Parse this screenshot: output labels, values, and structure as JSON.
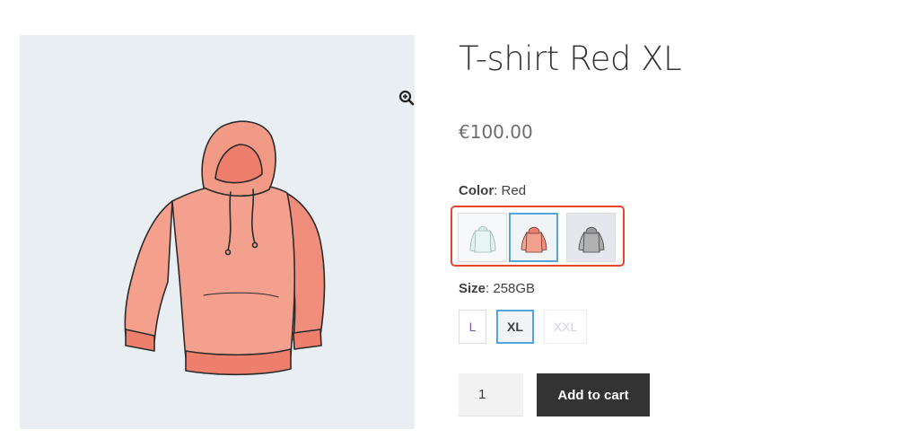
{
  "product": {
    "title": "T-shirt Red XL",
    "price": "€100.00"
  },
  "color": {
    "label": "Color",
    "selected": "Red",
    "swatches": [
      {
        "name": "light-blue-hoodie",
        "color": "#dff0f0",
        "selected": false
      },
      {
        "name": "red-hoodie",
        "color": "#f08a7a",
        "selected": true
      },
      {
        "name": "grey-hoodie",
        "color": "#a9a9a9",
        "selected": false
      }
    ],
    "highlight_color": "#e8452f"
  },
  "size": {
    "label": "Size",
    "selected": "258GB",
    "options": [
      {
        "label": "L",
        "state": "available"
      },
      {
        "label": "XL",
        "state": "selected"
      },
      {
        "label": "XXL",
        "state": "disabled"
      }
    ]
  },
  "cart": {
    "quantity": "1",
    "button_label": "Add to cart"
  },
  "icons": {
    "zoom": "zoom-in-icon"
  },
  "colors": {
    "accent": "#52a7d6",
    "button_bg": "#333333",
    "gallery_bg": "#e9eef2"
  }
}
